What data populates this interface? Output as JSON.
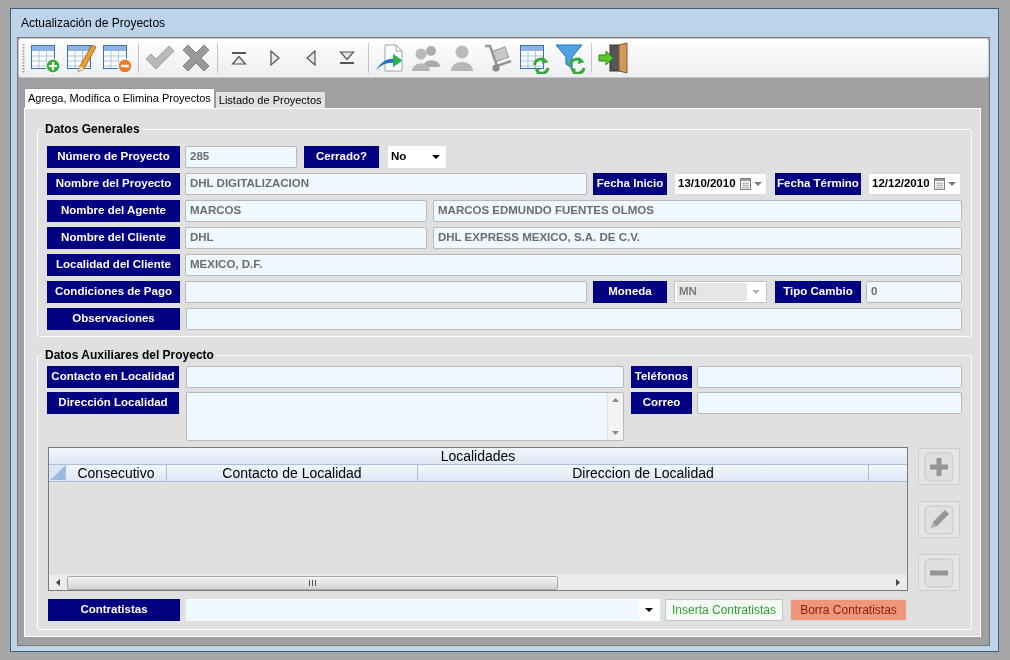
{
  "window": {
    "title": "Actualización de Proyectos"
  },
  "toolbar": {
    "groups": [
      {
        "buttons": [
          {
            "kind": "table-add",
            "disabled": false
          },
          {
            "kind": "table-edit",
            "disabled": false
          },
          {
            "kind": "table-remove",
            "disabled": false
          }
        ]
      },
      {
        "buttons": [
          {
            "kind": "accept",
            "disabled": true
          },
          {
            "kind": "cancel",
            "disabled": true
          }
        ]
      },
      {
        "buttons": [
          {
            "kind": "first",
            "disabled": false
          },
          {
            "kind": "next",
            "disabled": false
          },
          {
            "kind": "previous",
            "disabled": false
          },
          {
            "kind": "last",
            "disabled": false
          }
        ]
      },
      {
        "buttons": [
          {
            "kind": "export",
            "disabled": false
          },
          {
            "kind": "users",
            "disabled": true
          },
          {
            "kind": "user",
            "disabled": true
          },
          {
            "kind": "hand-truck",
            "disabled": true
          },
          {
            "kind": "table-refresh",
            "disabled": false
          },
          {
            "kind": "filter-refresh",
            "disabled": false
          }
        ]
      },
      {
        "buttons": [
          {
            "kind": "exit",
            "disabled": false
          }
        ]
      }
    ]
  },
  "tabs": [
    {
      "label": "Agrega, Modifica o Elimina Proyectos",
      "selected": true
    },
    {
      "label": "Listado de Proyectos",
      "selected": false
    }
  ],
  "datos_generales": {
    "title": "Datos Generales",
    "numero_de_proyecto": {
      "label": "Número de Proyecto",
      "value": "285"
    },
    "cerrado": {
      "label": "Cerrado?",
      "value": "No"
    },
    "nombre_del_proyecto": {
      "label": "Nombre del Proyecto",
      "value": "DHL DIGITALIZACION"
    },
    "fecha_inicio": {
      "label": "Fecha Inicio",
      "value": "13/10/2010"
    },
    "fecha_termino": {
      "label": "Fecha Término",
      "value": "12/12/2010"
    },
    "nombre_del_agente": {
      "label": "Nombre del Agente",
      "code": "MARCOS",
      "name": "MARCOS EDMUNDO FUENTES OLMOS"
    },
    "nombre_del_cliente": {
      "label": "Nombre del Cliente",
      "code": "DHL",
      "name": "DHL EXPRESS MEXICO, S.A. DE C.V."
    },
    "localidad_del_cliente": {
      "label": "Localidad del Cliente",
      "value": "MEXICO, D.F."
    },
    "condiciones_de_pago": {
      "label": "Condiciones de Pago"
    },
    "moneda": {
      "label": "Moneda",
      "value": "MN",
      "disabled": true
    },
    "tipo_cambio": {
      "label": "Tipo Cambio",
      "value": "0"
    },
    "observaciones": {
      "label": "Observaciones"
    }
  },
  "datos_auxiliares": {
    "title": "Datos Auxiliares del Proyecto",
    "contacto_en_localidad": {
      "label": "Contacto en Localidad"
    },
    "telefonos": {
      "label": "Teléfonos"
    },
    "direccion_localidad": {
      "label": "Dirección Localidad"
    },
    "correo": {
      "label": "Correo"
    },
    "localidades": {
      "title": "Localidades",
      "columns": [
        "Consecutivo",
        "Contacto de Localidad",
        "Direccion de Localidad"
      ]
    },
    "row_buttons": [
      {
        "kind": "add",
        "disabled": true
      },
      {
        "kind": "edit",
        "disabled": true
      },
      {
        "kind": "remove",
        "disabled": true
      }
    ],
    "contratistas": {
      "label": "Contratistas"
    },
    "buttons": [
      {
        "kind": "insert",
        "label": "Inserta Contratistas"
      },
      {
        "kind": "delete",
        "label": "Borra Contratistas"
      }
    ]
  }
}
